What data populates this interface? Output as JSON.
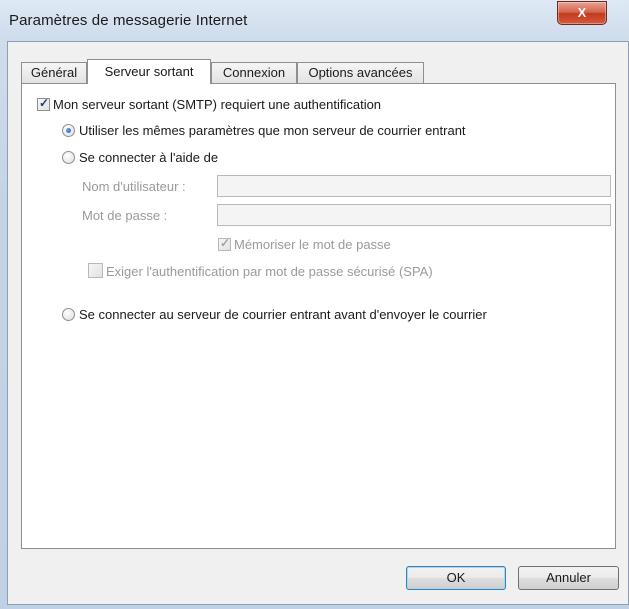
{
  "window": {
    "title": "Paramètres de messagerie Internet",
    "close_label": "X"
  },
  "tabs": [
    {
      "label": "Général",
      "active": false
    },
    {
      "label": "Serveur sortant",
      "active": true
    },
    {
      "label": "Connexion",
      "active": false
    },
    {
      "label": "Options avancées",
      "active": false
    }
  ],
  "panel": {
    "smtp_auth": {
      "label": "Mon serveur sortant (SMTP) requiert une authentification",
      "checked": true
    },
    "radio_same": {
      "label": "Utiliser les mêmes paramètres que mon serveur de courrier entrant",
      "selected": true
    },
    "radio_connect": {
      "label": "Se connecter à l'aide de",
      "selected": false
    },
    "username": {
      "label": "Nom d'utilisateur :",
      "value": ""
    },
    "password": {
      "label": "Mot de passe :",
      "value": ""
    },
    "remember": {
      "label": "Mémoriser le mot de passe",
      "checked": true,
      "disabled": true
    },
    "spa": {
      "label": "Exiger l'authentification par mot de passe sécurisé (SPA)",
      "checked": false,
      "disabled": true
    },
    "radio_before": {
      "label": "Se connecter au serveur de courrier entrant avant d'envoyer le courrier",
      "selected": false
    }
  },
  "buttons": {
    "ok": "OK",
    "cancel": "Annuler"
  },
  "icons": {
    "cursor": "arrow-cursor-icon"
  },
  "colors": {
    "title_gradient_top": "#dfe9f4",
    "close_red": "#c2391f",
    "radio_selected": "#1c5ab3"
  }
}
